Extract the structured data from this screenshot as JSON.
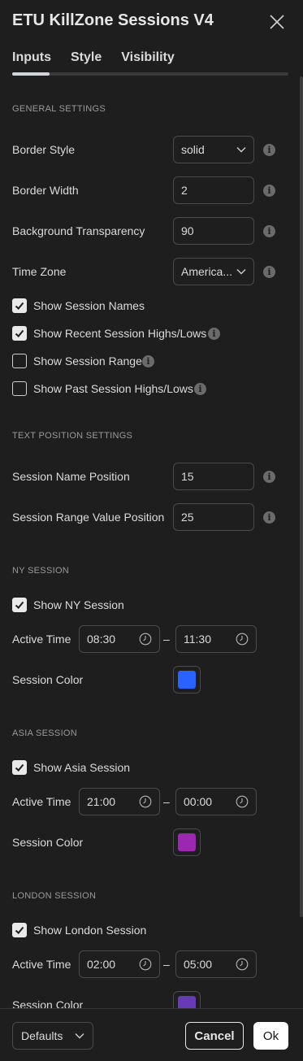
{
  "dialog": {
    "title": "ETU KillZone Sessions V4",
    "tabs": [
      "Inputs",
      "Style",
      "Visibility"
    ],
    "active_tab": "Inputs"
  },
  "general": {
    "heading": "GENERAL SETTINGS",
    "border_style": {
      "label": "Border Style",
      "value": "solid"
    },
    "border_width": {
      "label": "Border Width",
      "value": "2"
    },
    "bg_transparency": {
      "label": "Background Transparency",
      "value": "90"
    },
    "time_zone": {
      "label": "Time Zone",
      "value": "America..."
    },
    "show_session_names": {
      "label": "Show Session Names",
      "checked": true
    },
    "show_recent_highs_lows": {
      "label": "Show Recent Session Highs/Lows",
      "checked": true
    },
    "show_session_range": {
      "label": "Show Session Range",
      "checked": false
    },
    "show_past_highs_lows": {
      "label": "Show Past Session Highs/Lows",
      "checked": false
    }
  },
  "text_position": {
    "heading": "TEXT POSITION SETTINGS",
    "session_name_position": {
      "label": "Session Name Position",
      "value": "15"
    },
    "session_range_value_position": {
      "label": "Session Range Value Position",
      "value": "25"
    }
  },
  "ny": {
    "heading": "NY SESSION",
    "show": {
      "label": "Show NY Session",
      "checked": true
    },
    "active_time": {
      "label": "Active Time",
      "start": "08:30",
      "end": "11:30"
    },
    "color": {
      "label": "Session Color",
      "value": "#2962ff"
    }
  },
  "asia": {
    "heading": "ASIA SESSION",
    "show": {
      "label": "Show Asia Session",
      "checked": true
    },
    "active_time": {
      "label": "Active Time",
      "start": "21:00",
      "end": "00:00"
    },
    "color": {
      "label": "Session Color",
      "value": "#9c27b0"
    }
  },
  "london": {
    "heading": "LONDON SESSION",
    "show": {
      "label": "Show London Session",
      "checked": true
    },
    "active_time": {
      "label": "Active Time",
      "start": "02:00",
      "end": "05:00"
    },
    "color": {
      "label": "Session Color",
      "value": "#673ab7"
    }
  },
  "time_separator": "–",
  "footer": {
    "defaults_label": "Defaults",
    "cancel_label": "Cancel",
    "ok_label": "Ok"
  },
  "icons": {
    "info": "info-icon",
    "clock": "clock-icon",
    "chevron": "chevron-down-icon",
    "close": "close-icon",
    "check": "checkmark-icon"
  }
}
